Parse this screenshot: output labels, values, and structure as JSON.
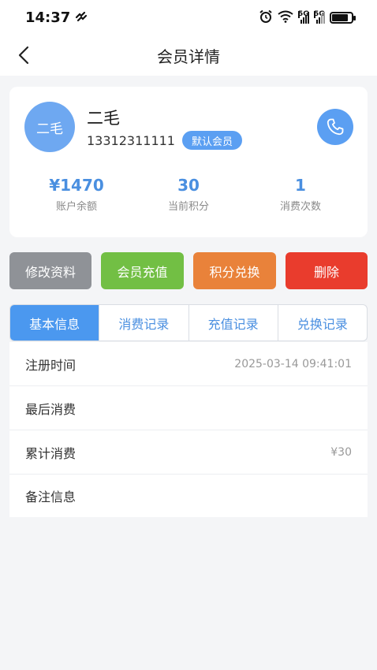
{
  "status_bar": {
    "time": "14:37",
    "net1": "5G",
    "net2": "5G",
    "battery_level": 0.85
  },
  "header": {
    "title": "会员详情"
  },
  "member": {
    "avatar_text": "二毛",
    "name": "二毛",
    "phone": "13312311111",
    "badge": "默认会员"
  },
  "stats": [
    {
      "value": "¥1470",
      "label": "账户余额"
    },
    {
      "value": "30",
      "label": "当前积分"
    },
    {
      "value": "1",
      "label": "消费次数"
    }
  ],
  "actions": [
    {
      "label": "修改资料",
      "color": "#8f9297"
    },
    {
      "label": "会员充值",
      "color": "#72bf44"
    },
    {
      "label": "积分兑换",
      "color": "#e9823a"
    },
    {
      "label": "删除",
      "color": "#e93c2d"
    }
  ],
  "tabs": [
    {
      "label": "基本信息",
      "active": true
    },
    {
      "label": "消费记录",
      "active": false
    },
    {
      "label": "充值记录",
      "active": false
    },
    {
      "label": "兑换记录",
      "active": false
    }
  ],
  "info": [
    {
      "label": "注册时间",
      "value": "2025-03-14 09:41:01"
    },
    {
      "label": "最后消费",
      "value": ""
    },
    {
      "label": "累计消费",
      "value": "¥30"
    },
    {
      "label": "备注信息",
      "value": ""
    }
  ],
  "colors": {
    "accent": "#5b9ff2",
    "tab_active": "#4b98ef",
    "stat_value": "#4a8fe0"
  },
  "icons": {
    "back": "chevron-left-icon",
    "phone": "phone-icon",
    "alarm": "alarm-icon",
    "wifi": "wifi-icon",
    "battery": "battery-icon"
  }
}
